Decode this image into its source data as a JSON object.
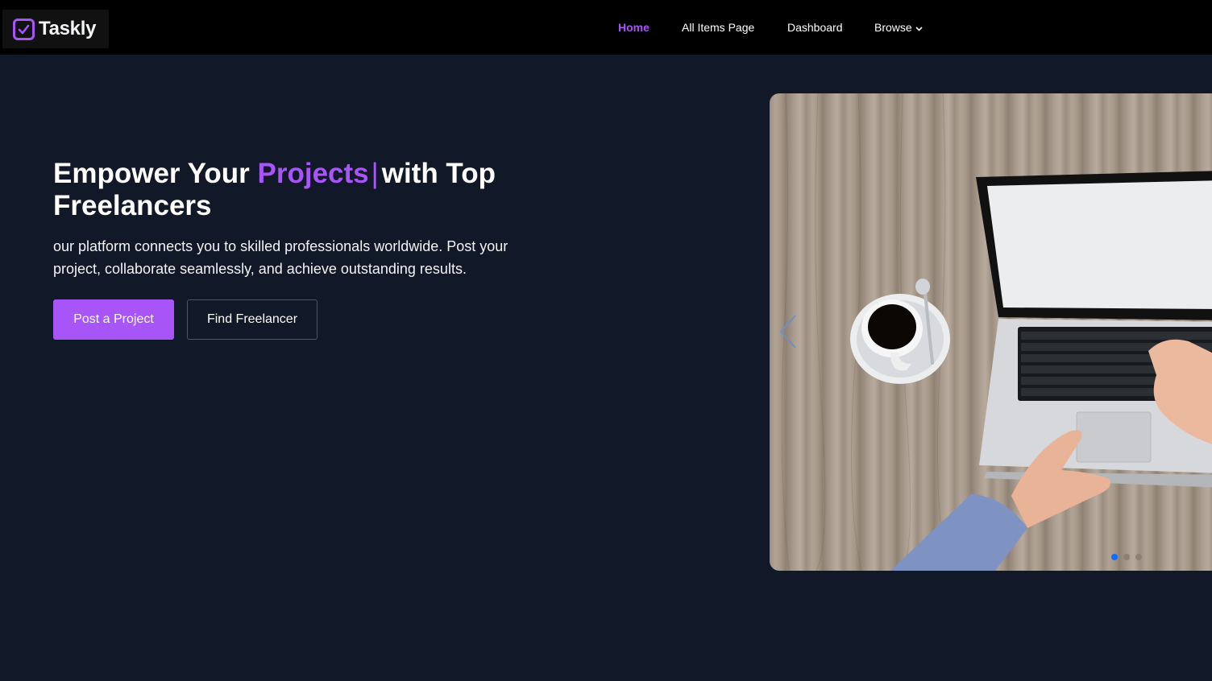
{
  "brand": {
    "name": "Taskly",
    "icon": "checkbox-icon",
    "accent_color": "#a855f7"
  },
  "nav": {
    "home": "Home",
    "all_items": "All Items Page",
    "dashboard": "Dashboard",
    "browse": "Browse",
    "active_color": "#a855f7"
  },
  "hero": {
    "title_prefix": "Empower Your",
    "title_accent": "Projects",
    "title_cursor": "|",
    "title_suffix": "with Top Freelancers",
    "subtitle": "our platform connects you to skilled professionals worldwide. Post your project, collaborate seamlessly, and achieve outstanding results.",
    "primary_button": "Post a Project",
    "secondary_button": "Find Freelancer"
  },
  "slider": {
    "image": "laptop-and-coffee-on-wooden-desk",
    "prev_icon": "chevron-left-icon",
    "dots": 3,
    "active_dot": 1,
    "active_dot_color": "#0d6efd"
  }
}
